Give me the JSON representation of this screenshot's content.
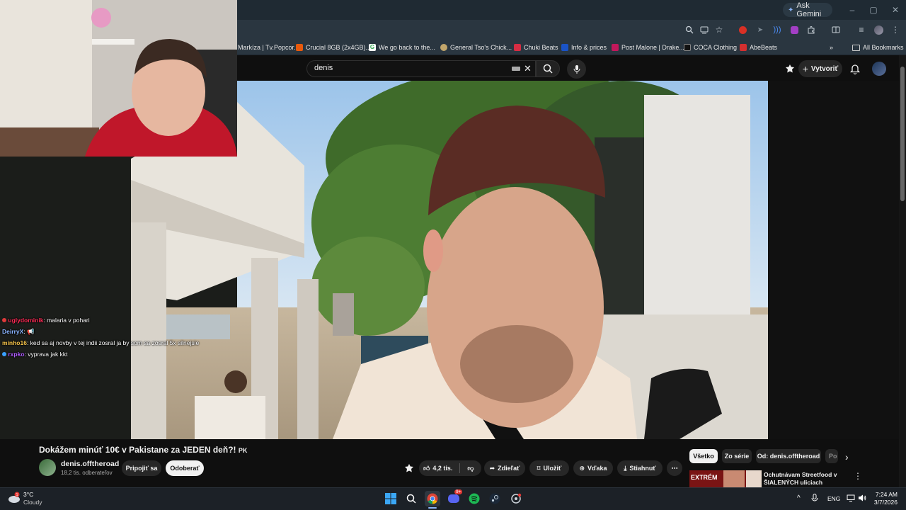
{
  "browser": {
    "ask_gemini": "Ask Gemini",
    "bookmarks": [
      {
        "label": "Markíza | Tv.Popcor...",
        "color": "#3a3a3a"
      },
      {
        "label": "Crucial 8GB (2x4GB)...",
        "color": "#e8590c"
      },
      {
        "label": "We go back to the...",
        "color": "#34a853"
      },
      {
        "label": "General Tso's Chick...",
        "color": "#c2a66b"
      },
      {
        "label": "Chuki Beats",
        "color": "#d62d43"
      },
      {
        "label": "Info & prices",
        "color": "#1a53c6"
      },
      {
        "label": "Post Malone | Drake...",
        "color": "#c2185b"
      },
      {
        "label": "COCA Clothing",
        "color": "#111111"
      },
      {
        "label": "AbeBeats",
        "color": "#d32f2f"
      }
    ],
    "all_bookmarks": "All Bookmarks"
  },
  "youtube": {
    "search_value": "denis",
    "create_label": "Vytvoriť",
    "video_title": "Dokážem minúť 10€ v Pakistane za JEDEN deň?! 🇵🇰",
    "video_title_text": "Dokážem minúť 10€ v Pakistane za JEDEN deň?!",
    "video_title_flag": "PK",
    "channel_name": "denis.offtheroad",
    "subscribers": "18,2 tis. odberateľov",
    "join_label": "Pripojiť sa",
    "unsubscribe_label": "Odoberať",
    "likes": "4,2 tis.",
    "share_label": "Zdieľať",
    "save_label": "Uložiť",
    "thanks_label": "Vďaka",
    "download_label": "Stiahnuť",
    "chips": [
      "Všetko",
      "Zo série",
      "Od: denis.offtheroad",
      "Po"
    ],
    "recommendation": {
      "title": "Ochutnávam Streetfood v ŠIALENÝCH uliciach Pakistan...",
      "thumb_text": "EXTRÉM"
    }
  },
  "chat": [
    {
      "user": "uglydominik",
      "message": ": malaria v pohari",
      "color": "#ff2a55",
      "badge": "#e03a3a"
    },
    {
      "user": "DeirryX",
      "message": ": 📢",
      "color": "#8ab4ff",
      "badge": ""
    },
    {
      "user": "minho16",
      "message": ": ked sa aj novby v tej indii zosral ja by som sa zosral 5x silnejsie",
      "color": "#f4c24a",
      "badge": ""
    },
    {
      "user": "rxpko",
      "message": ": vyprava jak kkt",
      "color": "#b05cff",
      "badge": "#3aa0ff"
    }
  ],
  "taskbar": {
    "weather_temp": "3°C",
    "weather_desc": "Cloudy",
    "lang": "ENG",
    "time": "7:24 AM",
    "date": "3/7/2026",
    "discord_badge": "9+"
  },
  "colors": {
    "youtube_bg": "#0f0f0f",
    "button_bg": "#272727",
    "chrome_toolbar": "#2a3640",
    "taskbar_bg": "#1c2127"
  }
}
